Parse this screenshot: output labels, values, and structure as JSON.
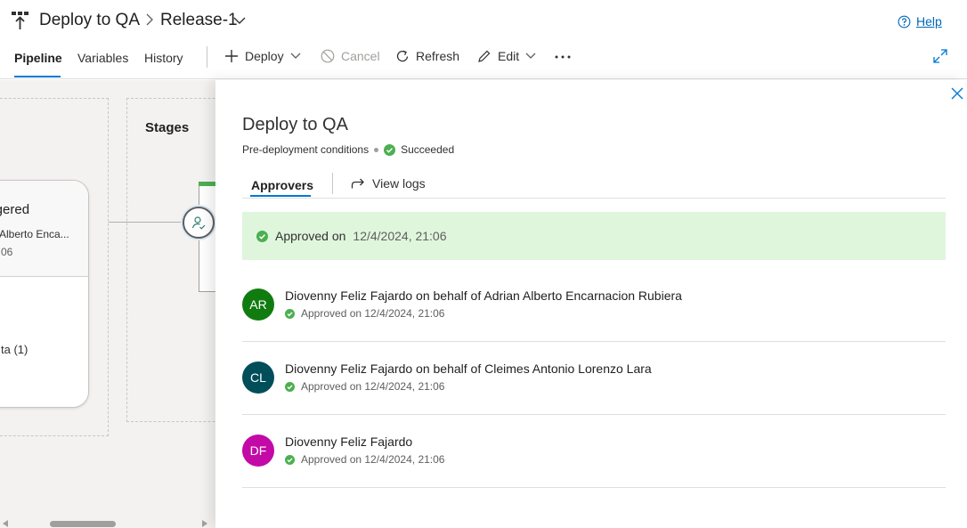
{
  "header": {
    "app_icon": "release-pipeline-icon",
    "title": "Deploy to QA",
    "release": "Release-1",
    "help_label": "Help"
  },
  "toolbar": {
    "tabs": [
      {
        "label": "Pipeline",
        "active": true
      },
      {
        "label": "Variables",
        "active": false
      },
      {
        "label": "History",
        "active": false
      }
    ],
    "deploy_label": "Deploy",
    "cancel_label": "Cancel",
    "refresh_label": "Refresh",
    "edit_label": "Edit"
  },
  "pipeline": {
    "artifact_title": "iggered",
    "artifact_by": "Alberto Enca...",
    "artifact_time": "06",
    "artifact_sub": "ta (1)",
    "stages_label": "Stages"
  },
  "panel": {
    "title": "Deploy to QA",
    "condition": "Pre-deployment conditions",
    "status": "Succeeded",
    "tabs": {
      "approvers": "Approvers",
      "view_logs": "View logs"
    },
    "banner": {
      "text": "Approved on",
      "date": "12/4/2024, 21:06"
    },
    "approvers": [
      {
        "initials": "AR",
        "color": "#107c10",
        "name": "Diovenny Feliz Fajardo on behalf of Adrian Alberto Encarnacion Rubiera",
        "status": "Approved on 12/4/2024, 21:06"
      },
      {
        "initials": "CL",
        "color": "#004e5a",
        "name": "Diovenny Feliz Fajardo on behalf of Cleimes Antonio Lorenzo Lara",
        "status": "Approved on 12/4/2024, 21:06"
      },
      {
        "initials": "DF",
        "color": "#c30aa7",
        "name": "Diovenny Feliz Fajardo",
        "status": "Approved on 12/4/2024, 21:06"
      }
    ]
  },
  "colors": {
    "accent": "#0078d4",
    "success": "#4caf50",
    "banner_bg": "#dff6dd",
    "link": "#0067b8"
  }
}
